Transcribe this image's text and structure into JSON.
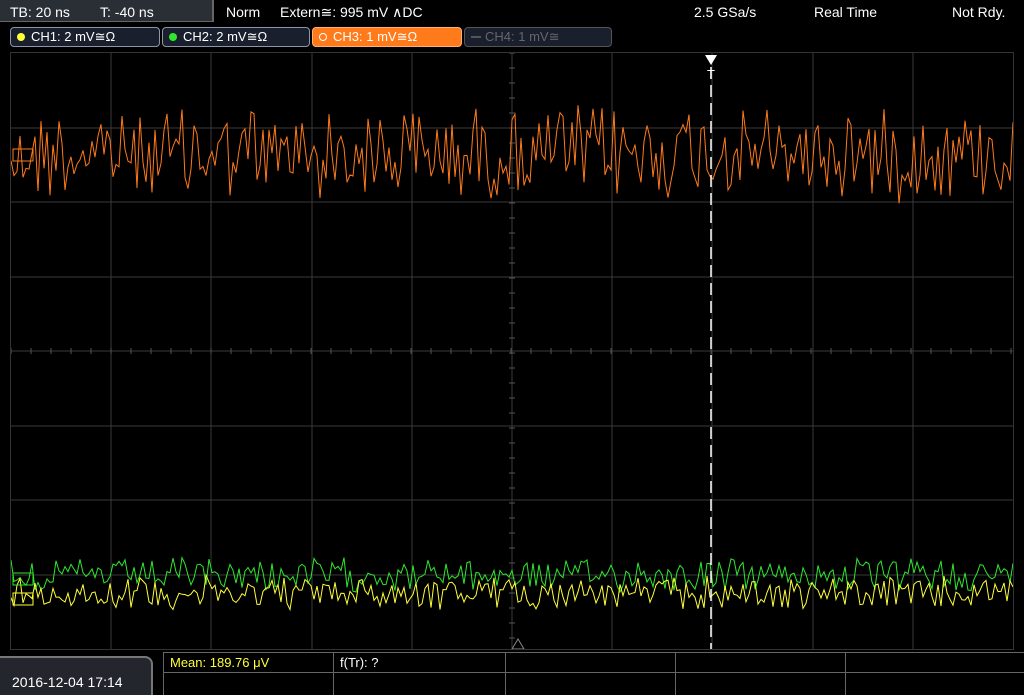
{
  "topbar": {
    "timebase": "TB: 20 ns",
    "trigger_time": "T: -40 ns",
    "mode": "Norm",
    "trigger": "Extern≅: 995 mV ∧DC",
    "sample_rate": "2.5 GSa/s",
    "acq_mode": "Real Time",
    "status": "Not Rdy."
  },
  "channels": [
    {
      "label": "CH1: 2 mV≅Ω",
      "color": "#ffff3a",
      "active": true
    },
    {
      "label": "CH2: 2 mV≅Ω",
      "color": "#2ee82e",
      "active": true
    },
    {
      "label": "CH3: 1 mV≅Ω",
      "color": "#ff7a1a",
      "active": true,
      "selected": true
    },
    {
      "label": "CH4: 1 mV≅",
      "color": "#666666",
      "active": false
    }
  ],
  "scope": {
    "trigger_marker": "T"
  },
  "bottombar": {
    "datetime": "2016-12-04 17:14",
    "mean": "Mean: 189.76 μV",
    "ftr": "f(Tr): ?"
  }
}
